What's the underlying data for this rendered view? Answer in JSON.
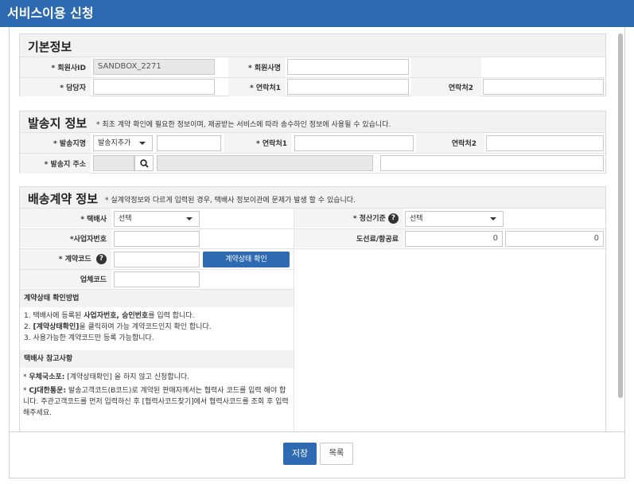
{
  "window": {
    "title": "서비스이용 신청"
  },
  "basic": {
    "title": "기본정보",
    "member_id_label": "* 회원사ID",
    "member_id_value": "SANDBOX_2271",
    "member_name_label": "* 회원사명",
    "manager_label": "* 담당자",
    "contact1_label": "* 연락처1",
    "contact2_label": "연락처2"
  },
  "sender": {
    "title": "발송지 정보",
    "note": "* 최초 계약 확인에 필요한 정보이며, 제공받는 서비스에 따라 송수하인 정보에 사용될 수 있습니다.",
    "name_label": "* 발송지명",
    "name_select": "발송지추가",
    "contact1_label": "* 연락처1",
    "contact2_label": "연락처2",
    "address_label": "* 발송지 주소"
  },
  "contract": {
    "title": "배송계약 정보",
    "note": "* 실계약정보와 다르게 입력된 경우, 택배사 정보이관에 문제가 발생 할 수 있습니다.",
    "carrier_label": "* 택배사",
    "carrier_select": "선택",
    "biz_no_label": "*사업자번호",
    "contract_code_label": "* 계약코드",
    "check_button": "계약상태 확인",
    "company_code_label": "업체코드",
    "settle_label": "* 정산기준",
    "settle_select": "선택",
    "fare_label": "도선료/항공료",
    "fare_value1": "0",
    "fare_value2": "0",
    "method_head": "계약상태 확인방법",
    "method_lines": [
      {
        "pre": "1. 택배사에 등록된 ",
        "bold": "사업자번호, 승인번호",
        "post": "를 입력 합니다."
      },
      {
        "pre": "2. ",
        "bold": "[계약상태확인]",
        "post": "을 클릭하여 가능 계약코드인지 확인 합니다."
      },
      {
        "pre": "3. 사용가능한 계약코드만 등록 가능합니다.",
        "bold": "",
        "post": ""
      }
    ],
    "ref_head": "택배사 참고사항",
    "ref_lines": [
      {
        "pre": "* ",
        "bold": "우체국소포:",
        "post": " [계약상태확인] 을 하지 않고 신청합니다."
      },
      {
        "pre": "* ",
        "bold": "CJ대한통운:",
        "post": " 발송고객코드(B코드)로 계약된 판매자께서는 협력사 코드를 입력 해야 합니다. 주관고객코드를 먼저 입력하신 후 [협력사코드찾기]에서 협력사코드를 조회 후 입력해주세요."
      }
    ]
  },
  "footer": {
    "save_label": "저장",
    "list_label": "목록"
  },
  "icons": {
    "help": "question-icon",
    "search": "search-icon",
    "dropdown": "chevron-down-icon"
  },
  "colors": {
    "accent": "#2d6ab1"
  }
}
